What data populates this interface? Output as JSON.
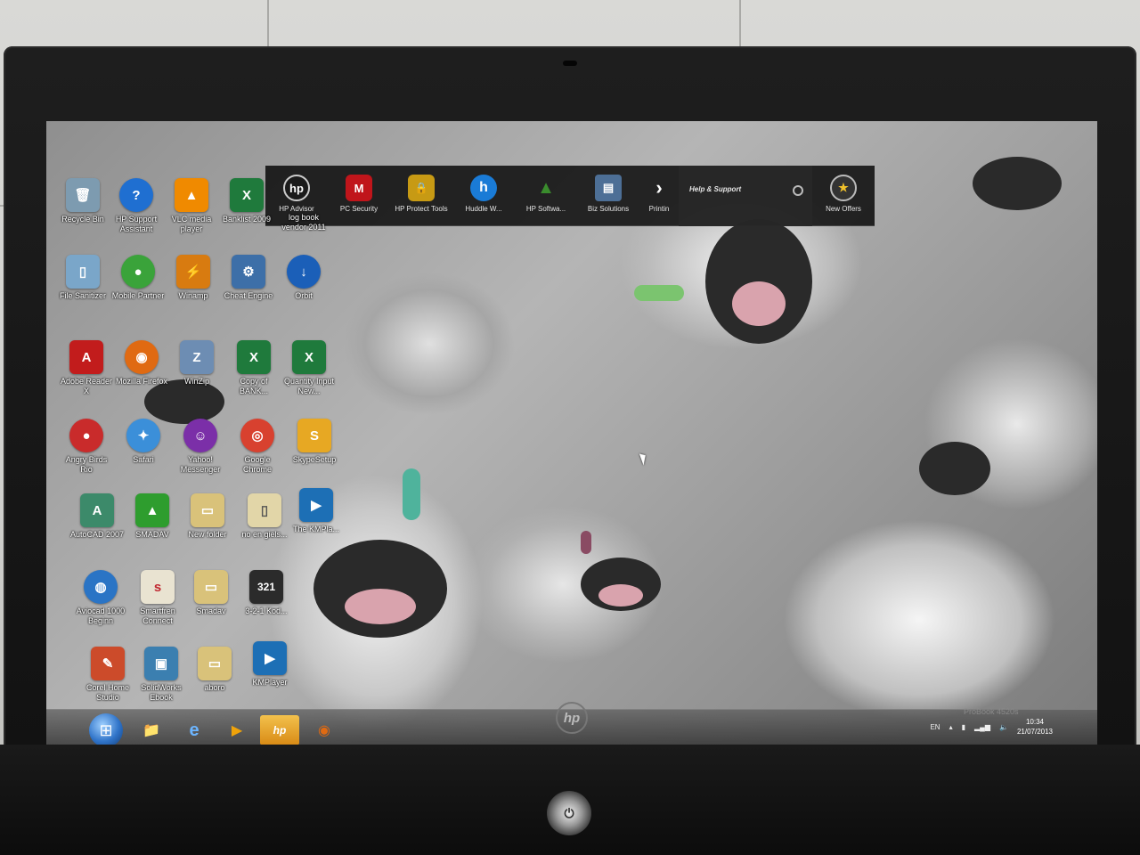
{
  "hp_quick_launch": {
    "items": [
      {
        "label": "HP Advisor",
        "icon": "hp-advisor-icon",
        "glyph": "hp",
        "color": "#1b1b1b"
      },
      {
        "label": "PC Security",
        "icon": "mcafee-shield-icon",
        "glyph": "M",
        "color": "#c0151b"
      },
      {
        "label": "HP Protect Tools",
        "icon": "lock-shield-icon",
        "glyph": "🔒",
        "color": "#c79a14"
      },
      {
        "label": "Huddle W...",
        "icon": "huddle-icon",
        "glyph": "h",
        "color": "#1a7bd6"
      },
      {
        "label": "HP Softwa...",
        "icon": "software-update-icon",
        "glyph": "▲",
        "color": "#3a8c2d"
      },
      {
        "label": "Biz Solutions",
        "icon": "biz-chart-icon",
        "glyph": "▤",
        "color": "#4d6f96"
      },
      {
        "label": "Printin",
        "icon": "arrow-right-icon",
        "glyph": "›",
        "color": "#333333"
      }
    ],
    "help_label": "Help & Support",
    "offers": {
      "label": "New Offers",
      "glyph": "★"
    }
  },
  "desktop_icons": [
    {
      "label": "Recycle Bin",
      "glyph": "🗑",
      "color": "#7d9bb0"
    },
    {
      "label": "HP Support Assistant",
      "glyph": "?",
      "color": "#1f6fd1"
    },
    {
      "label": "VLC media player",
      "glyph": "▲",
      "color": "#f08a00"
    },
    {
      "label": "Banklist 2009",
      "glyph": "X",
      "color": "#1f7a3c"
    },
    {
      "label": "log book vendor 2011",
      "glyph": "X",
      "color": "#1f7a3c"
    },
    {
      "label": "File Sanitizer",
      "glyph": "▯",
      "color": "#7aa6c9"
    },
    {
      "label": "Mobile Partner",
      "glyph": "●",
      "color": "#3aa33a"
    },
    {
      "label": "Winamp",
      "glyph": "⚡",
      "color": "#d87b10"
    },
    {
      "label": "Cheat Engine",
      "glyph": "⚙",
      "color": "#3d6fa8"
    },
    {
      "label": "Orbit",
      "glyph": "↓",
      "color": "#1b5fb8"
    },
    {
      "label": "Adobe Reader X",
      "glyph": "A",
      "color": "#c21c1c"
    },
    {
      "label": "Mozilla Firefox",
      "glyph": "◉",
      "color": "#e06a12"
    },
    {
      "label": "WinZip",
      "glyph": "Z",
      "color": "#6d8db3"
    },
    {
      "label": "Copy of BANK...",
      "glyph": "X",
      "color": "#1f7a3c"
    },
    {
      "label": "Quantity Input New...",
      "glyph": "X",
      "color": "#1f7a3c"
    },
    {
      "label": "Angry Birds Rio",
      "glyph": "●",
      "color": "#c92b2b"
    },
    {
      "label": "Safari",
      "glyph": "✦",
      "color": "#3b8fd9"
    },
    {
      "label": "Yahoo! Messenger",
      "glyph": "☺",
      "color": "#7b2fa8"
    },
    {
      "label": "Google Chrome",
      "glyph": "◎",
      "color": "#d8412f"
    },
    {
      "label": "SkypeSetup",
      "glyph": "S",
      "color": "#e7a823"
    },
    {
      "label": "AutoCAD 2007",
      "glyph": "A",
      "color": "#3c8a6a"
    },
    {
      "label": "SMADAV",
      "glyph": "▲",
      "color": "#2e9d2e"
    },
    {
      "label": "New folder",
      "glyph": "▭",
      "color": "#d9c27a"
    },
    {
      "label": "no en giels...",
      "glyph": "▯",
      "color": "#e2d6a8"
    },
    {
      "label": "The KMPla...",
      "glyph": "▶",
      "color": "#1d6fb5"
    },
    {
      "label": "Aviocad 1000 Beginn",
      "glyph": "◍",
      "color": "#2a74c5"
    },
    {
      "label": "Smartfren Connect",
      "glyph": "s",
      "color": "#e9e3d1"
    },
    {
      "label": "Smadav",
      "glyph": "▭",
      "color": "#d9c27a"
    },
    {
      "label": "3-2-1 Kod...",
      "glyph": "321",
      "color": "#2b2b2b"
    },
    {
      "label": "Corel Home Studio",
      "glyph": "✎",
      "color": "#cc4b2a"
    },
    {
      "label": "SolidWorks Ebook",
      "glyph": "▣",
      "color": "#3b7fb0"
    },
    {
      "label": "aboro",
      "glyph": "▭",
      "color": "#d9c27a"
    },
    {
      "label": "KMPlayer",
      "glyph": "▶",
      "color": "#1d6fb5"
    }
  ],
  "taskbar": {
    "start_glyph": "⊞",
    "pinned": [
      {
        "name": "explorer",
        "glyph": "📁"
      },
      {
        "name": "internet-explorer",
        "glyph": "e"
      },
      {
        "name": "media-player",
        "glyph": "▶"
      },
      {
        "name": "hp-advisor",
        "glyph": "hp"
      },
      {
        "name": "firefox",
        "glyph": "◉"
      }
    ],
    "tray_lang": "EN",
    "clock_time": "10:34",
    "clock_date": "21/07/2013"
  },
  "hardware": {
    "brand": "hp",
    "model": "ProBook 4520s"
  }
}
